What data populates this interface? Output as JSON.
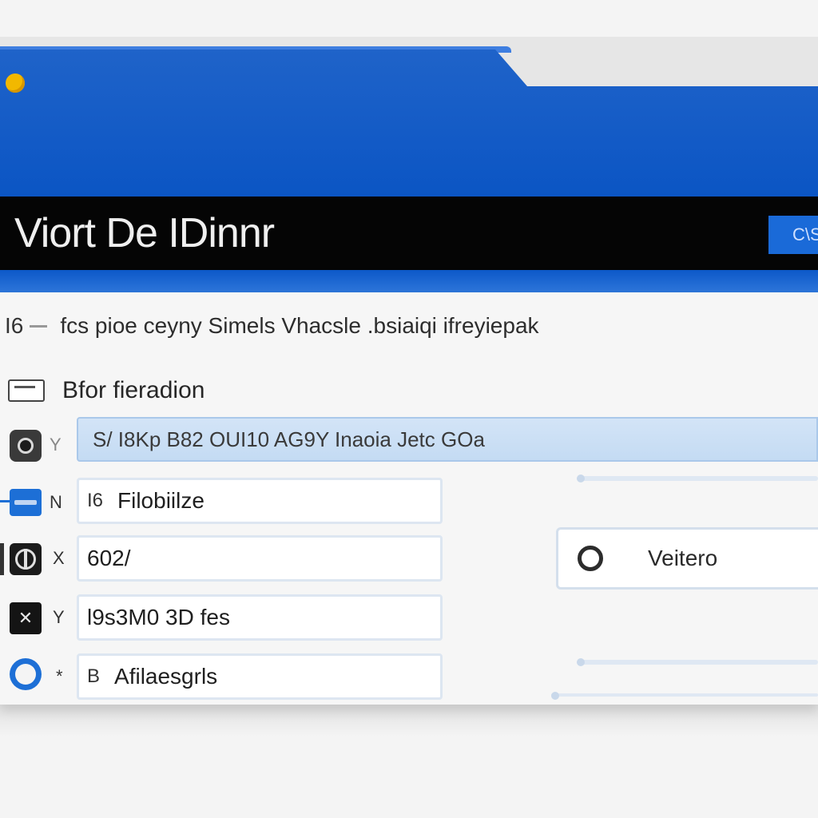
{
  "window": {
    "title": "Viort De IDinnr",
    "title_button_label": "C\\S",
    "status_dot_color": "#f2b800",
    "accent_color": "#0b55c4"
  },
  "description": {
    "number": "I6",
    "text": "fcs pioe ceyny Simels Vhacsle .bsiaiqi ifreyiepak"
  },
  "section": {
    "title": "Bfor fieradion",
    "icon": "panel-icon"
  },
  "rows": [
    {
      "icon": "camera-icon",
      "marker": "Y",
      "text": "S/ I8Kp B82 OUI10 AG9Y Inaoia Jetc GOa",
      "selected": true
    },
    {
      "icon": "card-icon",
      "marker": "N",
      "prefix": "I6",
      "text": "Filobiilze"
    },
    {
      "icon": "globe-icon",
      "marker": "X",
      "text": "602/"
    },
    {
      "icon": "tools-icon",
      "marker": "Y",
      "text": "l9s3M0 3D fes"
    },
    {
      "icon": "circle-icon",
      "marker": "*",
      "prefix": "B",
      "text": "Afilaesgrls"
    }
  ],
  "options": {
    "radio_label": "Veitero"
  }
}
